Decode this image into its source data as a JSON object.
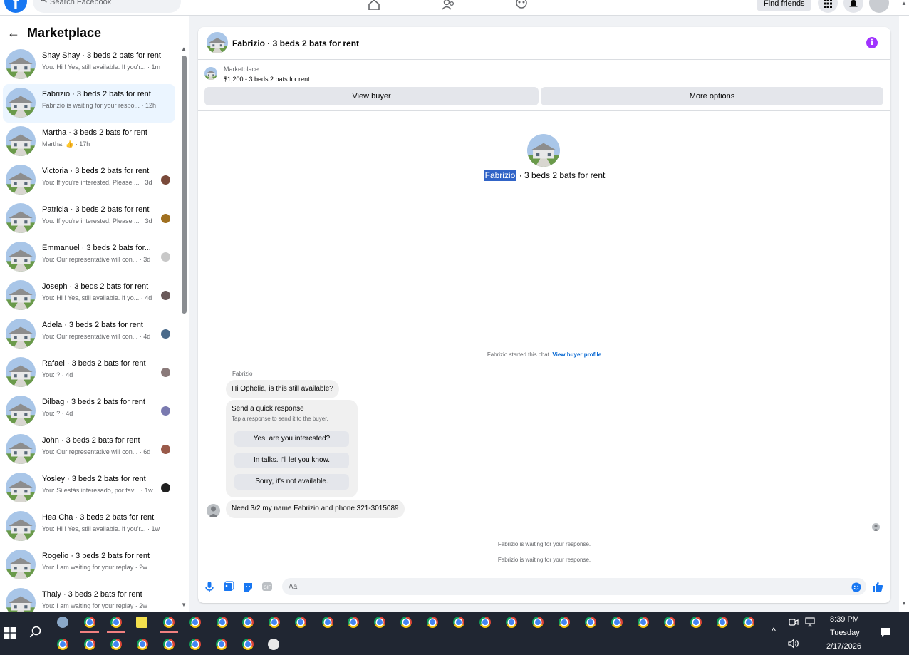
{
  "topbar": {
    "logo": "f",
    "search_placeholder": "Search Facebook",
    "find_friends": "Find friends",
    "icons": [
      "home-icon",
      "friends-icon",
      "groups-icon",
      "menu-grid-icon",
      "bell-icon"
    ]
  },
  "sidebar": {
    "title": "Marketplace",
    "conversations": [
      {
        "name": "Shay Shay · 3 beds 2 bats for rent",
        "snippet": "You: Hi ! Yes, still available. If you'r... · 1m",
        "mini": "",
        "active": false
      },
      {
        "name": "Fabrizio · 3 beds 2 bats for rent",
        "snippet": "Fabrizio is waiting for your respo... · 12h",
        "mini": "",
        "active": true
      },
      {
        "name": "Martha · 3 beds 2 bats for rent",
        "snippet": "Martha: 👍 · 17h",
        "mini": "",
        "active": false
      },
      {
        "name": "Victoria · 3 beds 2 bats for rent",
        "snippet": "You: If you're interested, Please ... · 3d",
        "mini": "#7a4a3a",
        "active": false
      },
      {
        "name": "Patricia · 3 beds 2 bats for rent",
        "snippet": "You: If you're interested, Please ... · 3d",
        "mini": "#a07020",
        "active": false
      },
      {
        "name": "Emmanuel · 3 beds 2 bats for...",
        "snippet": "You: Our representative will con... · 3d",
        "mini": "#c8c8c8",
        "active": false
      },
      {
        "name": "Joseph · 3 beds 2 bats for rent",
        "snippet": "You: Hi ! Yes, still available. If yo... · 4d",
        "mini": "#6a5a5a",
        "active": false
      },
      {
        "name": "Adela · 3 beds 2 bats for rent",
        "snippet": "You: Our representative will con... · 4d",
        "mini": "#4a6a8a",
        "active": false
      },
      {
        "name": "Rafael · 3 beds 2 bats for rent",
        "snippet": "You: ? · 4d",
        "mini": "#8a7a7a",
        "active": false
      },
      {
        "name": "Dilbag · 3 beds 2 bats for rent",
        "snippet": "You: ? · 4d",
        "mini": "#7a7ab0",
        "active": false
      },
      {
        "name": "John · 3 beds 2 bats for rent",
        "snippet": "You: Our representative will con... · 6d",
        "mini": "#9a5a4a",
        "active": false
      },
      {
        "name": "Yosley · 3 beds 2 bats for rent",
        "snippet": "You: Si estás interesado, por fav... · 1w",
        "mini": "#202020",
        "active": false
      },
      {
        "name": "Hea Cha · 3 beds 2 bats for rent",
        "snippet": "You: Hi ! Yes, still available. If you'r... · 1w",
        "mini": "",
        "active": false
      },
      {
        "name": "Rogelio · 3 beds 2 bats for rent",
        "snippet": "You: I am waiting for your replay · 2w",
        "mini": "",
        "active": false
      },
      {
        "name": "Thaly · 3 beds 2 bats for rent",
        "snippet": "You: I am waiting for your replay · 2w",
        "mini": "",
        "active": false
      }
    ]
  },
  "chat": {
    "title": "Fabrizio · 3 beds 2 bats for rent",
    "listing_source": "Marketplace",
    "listing_price": "$1,200 - 3 beds 2 bats for rent",
    "view_buyer": "View buyer",
    "more_options": "More options",
    "intro_name": "Fabrizio",
    "intro_rest": " · 3 beds 2 bats for rent",
    "started_text": "Fabrizio started this chat. ",
    "started_link": "View buyer profile",
    "sender_label": "Fabrizio",
    "message1": "Hi Ophelia, is this still available?",
    "quick_title": "Send a quick response",
    "quick_sub": "Tap a response to send it to the buyer.",
    "quick_replies": [
      "Yes, are you interested?",
      "In talks. I'll let you know.",
      "Sorry, it's not available."
    ],
    "message2": "Need 3/2 my name Fabrizio and phone 321-3015089",
    "waiting1": "Fabrizio is waiting for your response.",
    "waiting2": "Fabrizio is waiting for your response.",
    "input_placeholder": "Aa"
  },
  "taskbar": {
    "time": "8:39 PM",
    "day": "Tuesday",
    "date": "2/17/2026"
  },
  "colors": {
    "accent": "#1877f2",
    "info": "#a033ff",
    "taskbar": "#202632"
  }
}
